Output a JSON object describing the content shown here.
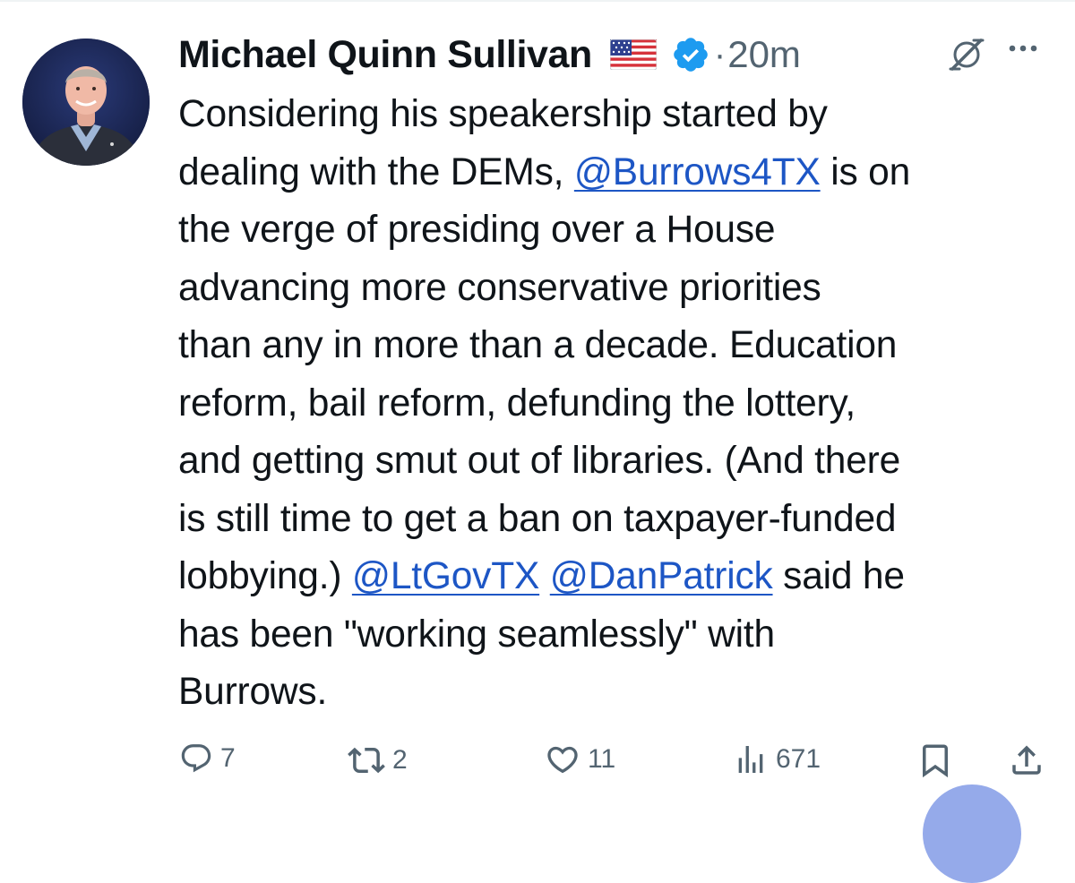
{
  "tweet": {
    "author_name": "Michael Quinn Sullivan",
    "timestamp": "20m",
    "separator": "·",
    "lines": [
      [
        {
          "t": "Considering his speakership started by"
        }
      ],
      [
        {
          "t": "dealing with the DEMs, "
        },
        {
          "t": "@Burrows4TX",
          "mention": true
        },
        {
          "t": " is on"
        }
      ],
      [
        {
          "t": "the verge of presiding over a House"
        }
      ],
      [
        {
          "t": "advancing more conservative priorities"
        }
      ],
      [
        {
          "t": "than any in more than a decade. Education"
        }
      ],
      [
        {
          "t": "reform, bail reform, defunding the lottery,"
        }
      ],
      [
        {
          "t": "and getting smut out of libraries. (And there"
        }
      ],
      [
        {
          "t": "is still time to get a ban on taxpayer-funded"
        }
      ],
      [
        {
          "t": "lobbying.) "
        },
        {
          "t": "@LtGovTX",
          "mention": true
        },
        {
          "t": " "
        },
        {
          "t": "@DanPatrick",
          "mention": true
        },
        {
          "t": " said he"
        }
      ],
      [
        {
          "t": "has been \"working seamlessly\" with"
        }
      ],
      [
        {
          "t": "Burrows."
        }
      ]
    ]
  },
  "actions": {
    "reply_count": "7",
    "retweet_count": "2",
    "like_count": "11",
    "view_count": "671"
  },
  "icons": {
    "author_flag": "us-flag-icon",
    "verified": "verified-badge-icon",
    "grok": "grok-icon",
    "more": "more-options-icon",
    "reply": "reply-icon",
    "retweet": "retweet-icon",
    "like": "heart-icon",
    "views": "views-icon",
    "bookmark": "bookmark-icon",
    "share": "share-icon"
  },
  "colors": {
    "text": "#0f1419",
    "secondary": "#536471",
    "mention": "#1d56c5",
    "verified": "#1d9bf0"
  }
}
